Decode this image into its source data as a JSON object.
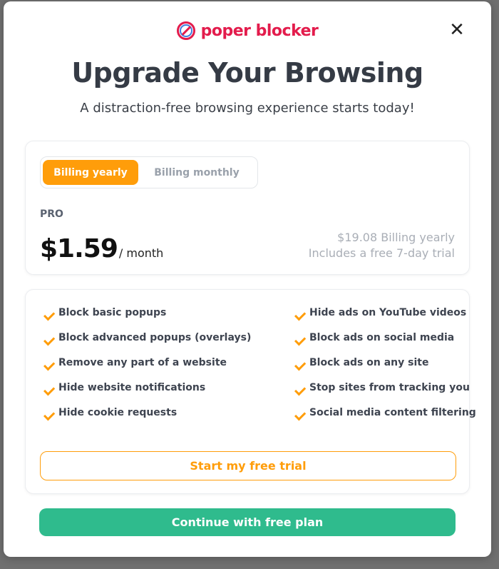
{
  "brand": {
    "name": "poper blocker",
    "color": "#e31c4c"
  },
  "header": {
    "close_icon": "close-icon",
    "close_glyph": "✕",
    "title": "Upgrade Your Browsing",
    "subtitle": "A distraction-free browsing experience starts today!"
  },
  "pricing": {
    "toggle": {
      "yearly_label": "Billing yearly",
      "monthly_label": "Billing monthly",
      "selected": "yearly"
    },
    "plan": "PRO",
    "price": "$1.59",
    "per": "/ month",
    "billing_total": "$19.08 Billing yearly",
    "trial_note": "Includes a free 7-day trial"
  },
  "features": {
    "left": [
      "Block basic popups",
      "Block advanced popups (overlays)",
      "Remove any part of a website",
      "Hide website notifications",
      "Hide cookie requests"
    ],
    "right": [
      "Hide ads on YouTube videos",
      "Block ads on social media",
      "Block ads on any site",
      "Stop sites from tracking you",
      "Social media content filtering"
    ]
  },
  "actions": {
    "trial_label": "Start my free trial",
    "free_label": "Continue with free plan"
  },
  "colors": {
    "accent": "#ff9d0a",
    "success": "#2fbb8d",
    "title": "#353b45"
  }
}
